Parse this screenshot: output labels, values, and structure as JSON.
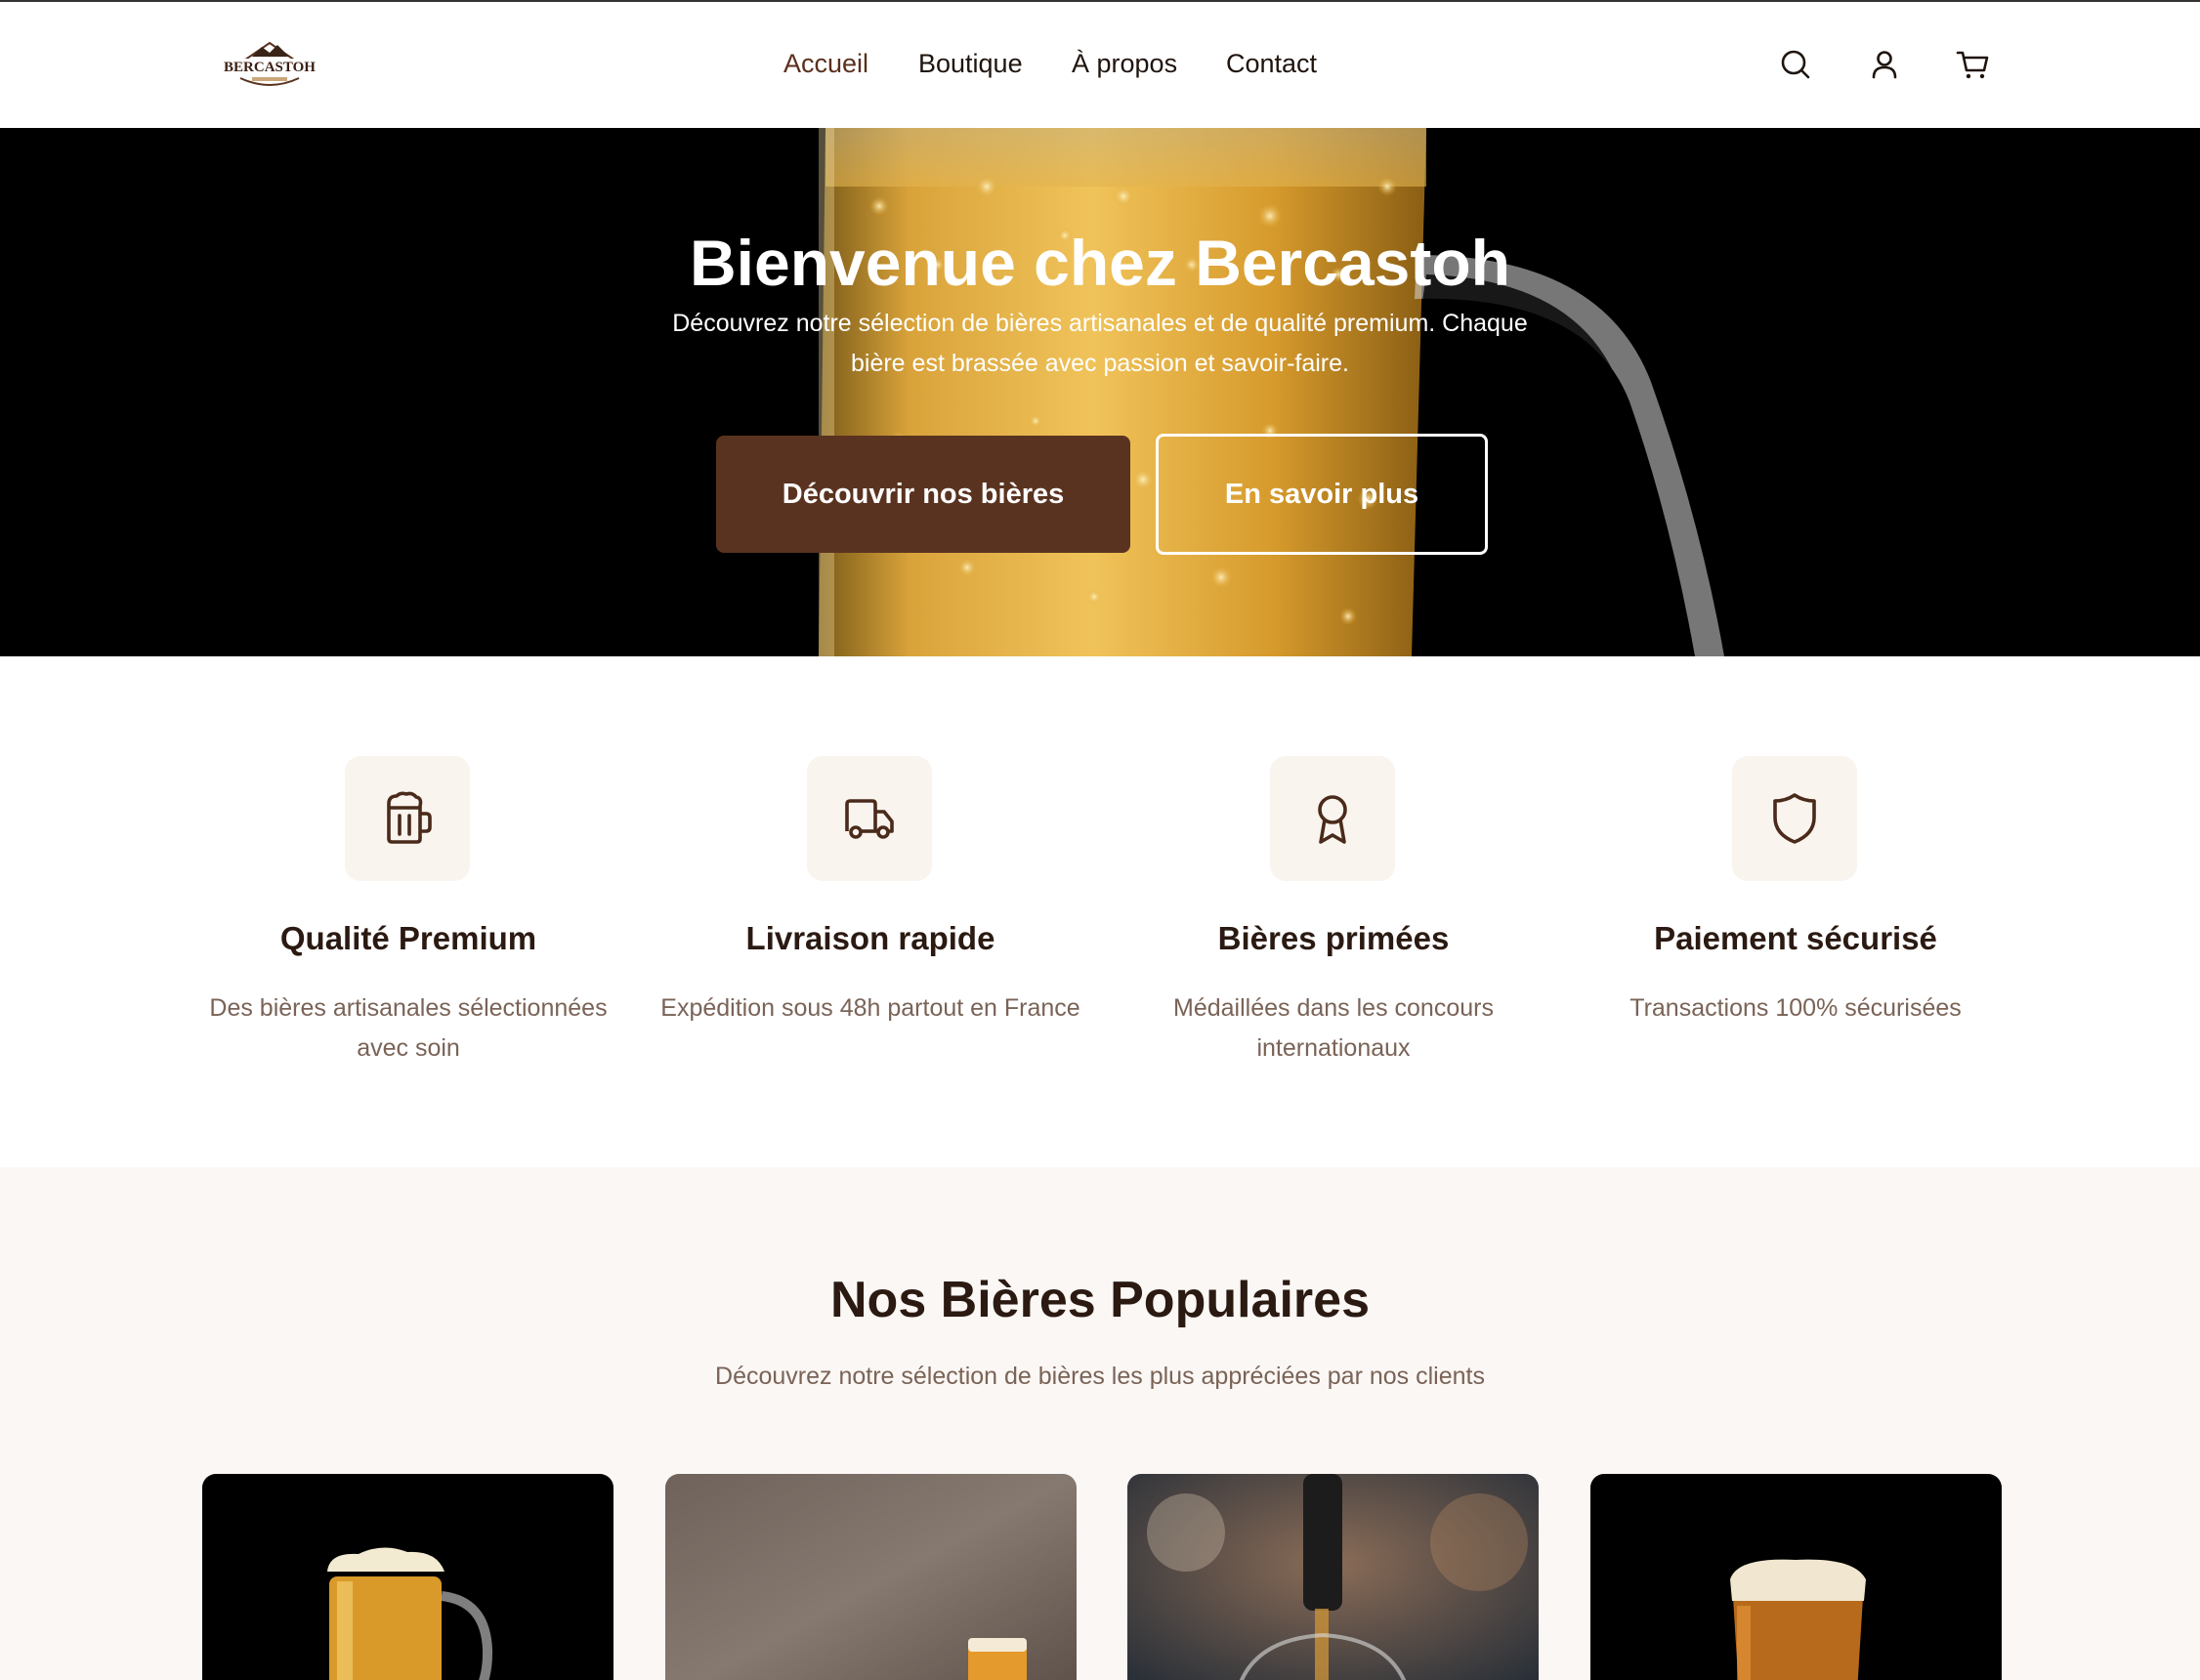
{
  "brand": {
    "logo_text": "BERCASTOH"
  },
  "nav": {
    "items": [
      {
        "label": "Accueil",
        "active": true
      },
      {
        "label": "Boutique",
        "active": false
      },
      {
        "label": "À propos",
        "active": false
      },
      {
        "label": "Contact",
        "active": false
      }
    ],
    "icons": [
      "search-icon",
      "user-icon",
      "cart-icon"
    ]
  },
  "hero": {
    "title": "Bienvenue chez Bercastoh",
    "subtitle": "Découvrez notre sélection de bières artisanales et de qualité premium. Chaque bière est brassée avec passion et savoir-faire.",
    "primary_button": "Découvrir nos bières",
    "secondary_button": "En savoir plus"
  },
  "features": [
    {
      "icon": "beer-mug-icon",
      "title": "Qualité Premium",
      "desc": "Des bières artisanales sélectionnées avec soin"
    },
    {
      "icon": "truck-icon",
      "title": "Livraison rapide",
      "desc": "Expédition sous 48h partout en France"
    },
    {
      "icon": "award-icon",
      "title": "Bières primées",
      "desc": "Médaillées dans les concours internationaux"
    },
    {
      "icon": "shield-icon",
      "title": "Paiement sécurisé",
      "desc": "Transactions 100% sécurisées"
    }
  ],
  "popular": {
    "title": "Nos Bières Populaires",
    "subtitle": "Découvrez notre sélection de bières les plus appréciées par nos clients"
  },
  "colors": {
    "brand_brown": "#5a3320",
    "icon_brown": "#4a2a1a",
    "text_dark": "#2b1a12",
    "text_muted": "#7a6357",
    "cream_bg": "#fbf7f4"
  }
}
